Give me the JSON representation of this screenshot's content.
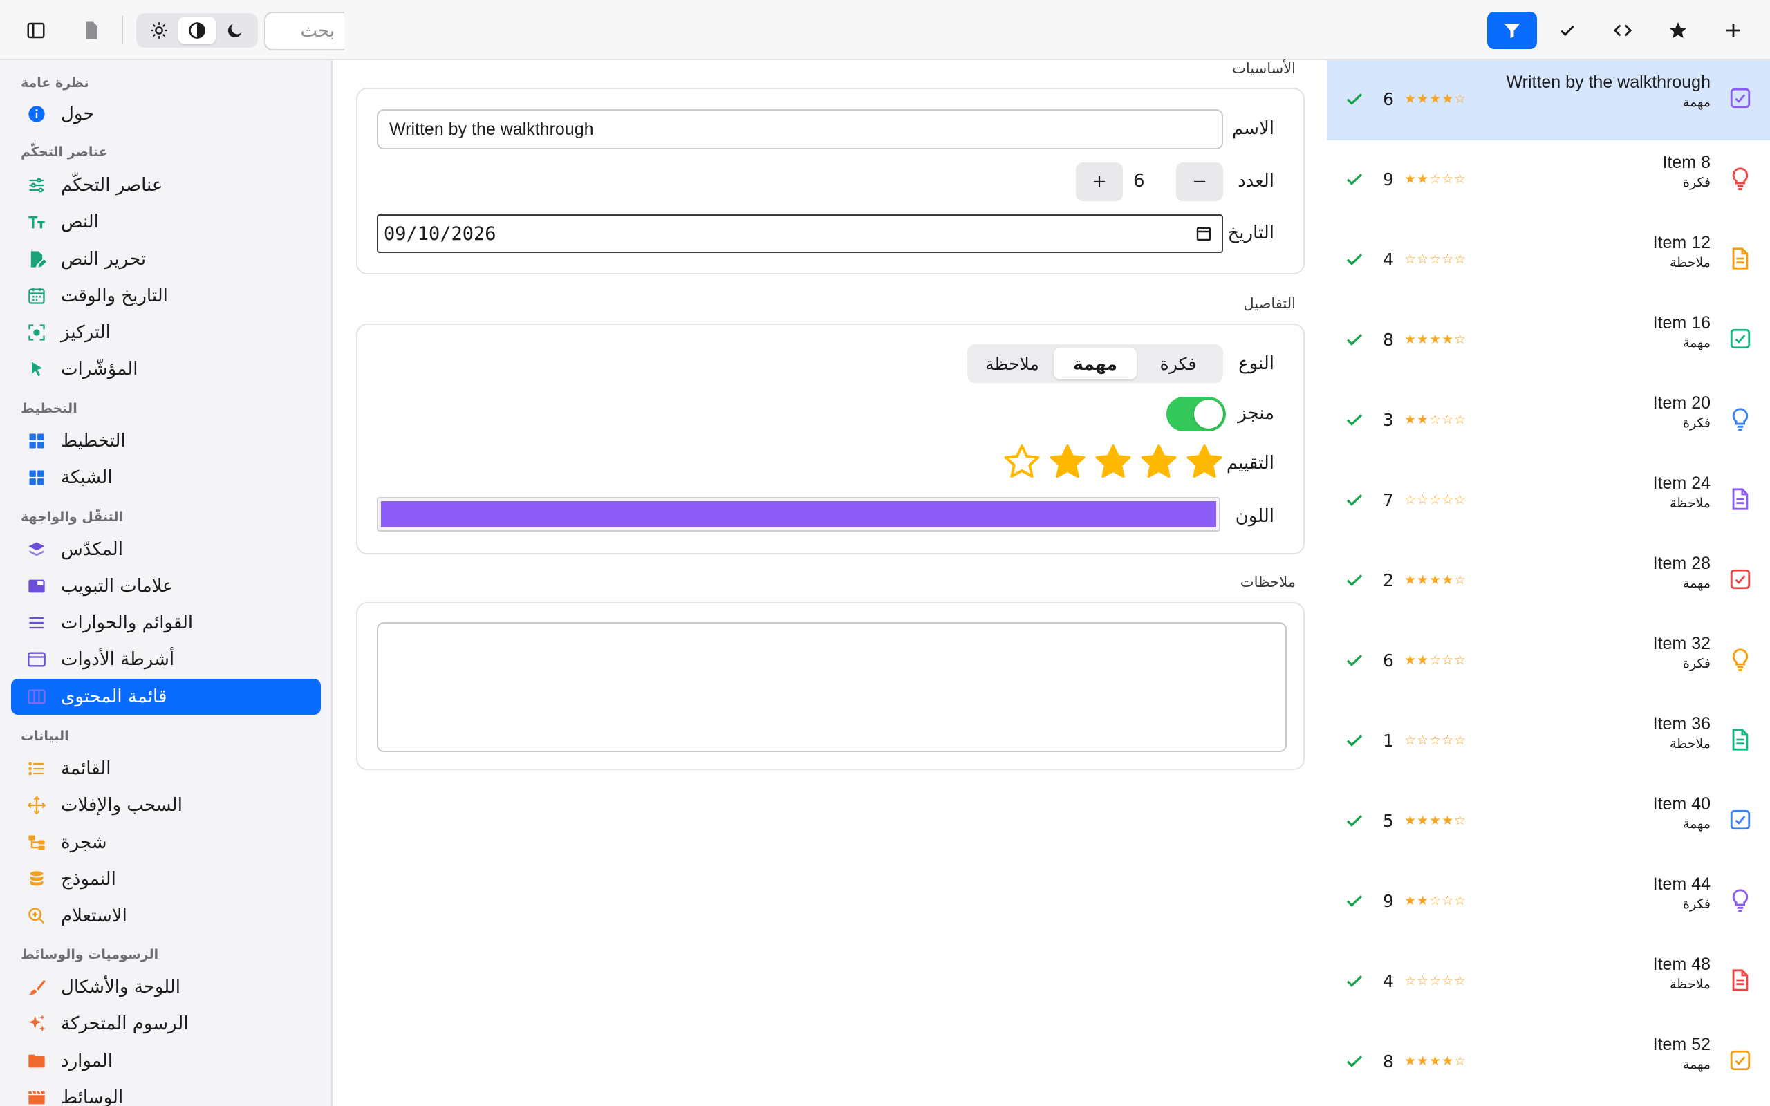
{
  "toolbar": {
    "search_placeholder": "بحث",
    "mode_options": [
      "light",
      "auto",
      "dark"
    ],
    "mode_selected": "auto",
    "right_buttons": [
      {
        "name": "filter",
        "active": true
      },
      {
        "name": "check",
        "active": false
      },
      {
        "name": "code",
        "active": false
      },
      {
        "name": "star",
        "active": false
      },
      {
        "name": "add",
        "active": false
      }
    ]
  },
  "sidebar": {
    "sections": [
      {
        "title": "نظرة عامة",
        "items": [
          {
            "label": "حول",
            "icon": "info-icon",
            "color": "#0a6cff"
          }
        ]
      },
      {
        "title": "عناصر التحكّم",
        "items": [
          {
            "label": "عناصر التحكّم",
            "icon": "sliders-icon",
            "color": "#1aa37a"
          },
          {
            "label": "النص",
            "icon": "text-size-icon",
            "color": "#1aa37a"
          },
          {
            "label": "تحرير النص",
            "icon": "edit-document-icon",
            "color": "#1aa37a"
          },
          {
            "label": "التاريخ والوقت",
            "icon": "calendar-icon",
            "color": "#1aa37a"
          },
          {
            "label": "التركيز",
            "icon": "focus-icon",
            "color": "#1aa37a"
          },
          {
            "label": "المؤشّرات",
            "icon": "pointer-icon",
            "color": "#1aa37a"
          }
        ]
      },
      {
        "title": "التخطيط",
        "items": [
          {
            "label": "التخطيط",
            "icon": "layout-grid-icon",
            "color": "#1f6fe5"
          },
          {
            "label": "الشبكة",
            "icon": "grid-icon",
            "color": "#1f6fe5"
          }
        ]
      },
      {
        "title": "التنقّل والواجهة",
        "items": [
          {
            "label": "المكدّس",
            "icon": "stack-icon",
            "color": "#6b4fd8"
          },
          {
            "label": "علامات التبويب",
            "icon": "tabs-icon",
            "color": "#6b4fd8"
          },
          {
            "label": "القوائم والحوارات",
            "icon": "menu-lines-icon",
            "color": "#6b4fd8"
          },
          {
            "label": "أشرطة الأدوات",
            "icon": "toolbar-window-icon",
            "color": "#6b4fd8"
          },
          {
            "label": "قائمة المحتوى",
            "icon": "split-view-icon",
            "color": "#6b4fd8",
            "active": true
          }
        ]
      },
      {
        "title": "البيانات",
        "items": [
          {
            "label": "القائمة",
            "icon": "list-icon",
            "color": "#f0a020"
          },
          {
            "label": "السحب والإفلات",
            "icon": "move-arrows-icon",
            "color": "#f0a020"
          },
          {
            "label": "شجرة",
            "icon": "tree-icon",
            "color": "#f0a020"
          },
          {
            "label": "النموذج",
            "icon": "database-icon",
            "color": "#f0a020"
          },
          {
            "label": "الاستعلام",
            "icon": "search-zoom-icon",
            "color": "#f0a020"
          }
        ]
      },
      {
        "title": "الرسوميات والوسائط",
        "items": [
          {
            "label": "اللوحة والأشكال",
            "icon": "brush-icon",
            "color": "#f06a30"
          },
          {
            "label": "الرسوم المتحركة",
            "icon": "sparkles-icon",
            "color": "#f06a30"
          },
          {
            "label": "الموارد",
            "icon": "folder-icon",
            "color": "#f06a30"
          },
          {
            "label": "الوسائط",
            "icon": "film-icon",
            "color": "#f06a30"
          }
        ]
      }
    ]
  },
  "form": {
    "basics_title": "الأساسيات",
    "name_label": "الاسم",
    "name_value": "Written by the walkthrough",
    "count_label": "العدد",
    "count_value": "6",
    "minus_label": "−",
    "plus_label": "+",
    "date_label": "التاريخ",
    "date_value": "09/10/2026",
    "details_title": "التفاصيل",
    "type_label": "النوع",
    "type_options": [
      "فكرة",
      "مهمة",
      "ملاحظة"
    ],
    "type_selected": "مهمة",
    "done_label": "منجز",
    "done_value": true,
    "rating_label": "التقييم",
    "rating_value": 4,
    "rating_max": 5,
    "color_label": "اللون",
    "color_value": "#8b5cf6",
    "notes_title": "ملاحظات",
    "notes_value": ""
  },
  "list": {
    "items": [
      {
        "title": "Written by the walkthrough",
        "kind": "مهمة",
        "type": "task",
        "count": "6",
        "rating": 4,
        "color": "#8b5cf6",
        "selected": true
      },
      {
        "title": "Item 8",
        "kind": "فكرة",
        "type": "idea",
        "count": "9",
        "rating": 2,
        "color": "#ef4444"
      },
      {
        "title": "Item 12",
        "kind": "ملاحظة",
        "type": "note",
        "count": "4",
        "rating": 0,
        "color": "#f59e0b"
      },
      {
        "title": "Item 16",
        "kind": "مهمة",
        "type": "task",
        "count": "8",
        "rating": 4,
        "color": "#10b981"
      },
      {
        "title": "Item 20",
        "kind": "فكرة",
        "type": "idea",
        "count": "3",
        "rating": 2,
        "color": "#3b82f6"
      },
      {
        "title": "Item 24",
        "kind": "ملاحظة",
        "type": "note",
        "count": "7",
        "rating": 0,
        "color": "#8b5cf6"
      },
      {
        "title": "Item 28",
        "kind": "مهمة",
        "type": "task",
        "count": "2",
        "rating": 4,
        "color": "#ef4444"
      },
      {
        "title": "Item 32",
        "kind": "فكرة",
        "type": "idea",
        "count": "6",
        "rating": 2,
        "color": "#f59e0b"
      },
      {
        "title": "Item 36",
        "kind": "ملاحظة",
        "type": "note",
        "count": "1",
        "rating": 0,
        "color": "#10b981"
      },
      {
        "title": "Item 40",
        "kind": "مهمة",
        "type": "task",
        "count": "5",
        "rating": 4,
        "color": "#3b82f6"
      },
      {
        "title": "Item 44",
        "kind": "فكرة",
        "type": "idea",
        "count": "9",
        "rating": 2,
        "color": "#8b5cf6"
      },
      {
        "title": "Item 48",
        "kind": "ملاحظة",
        "type": "note",
        "count": "4",
        "rating": 0,
        "color": "#ef4444"
      },
      {
        "title": "Item 52",
        "kind": "مهمة",
        "type": "task",
        "count": "8",
        "rating": 4,
        "color": "#f59e0b"
      }
    ]
  }
}
